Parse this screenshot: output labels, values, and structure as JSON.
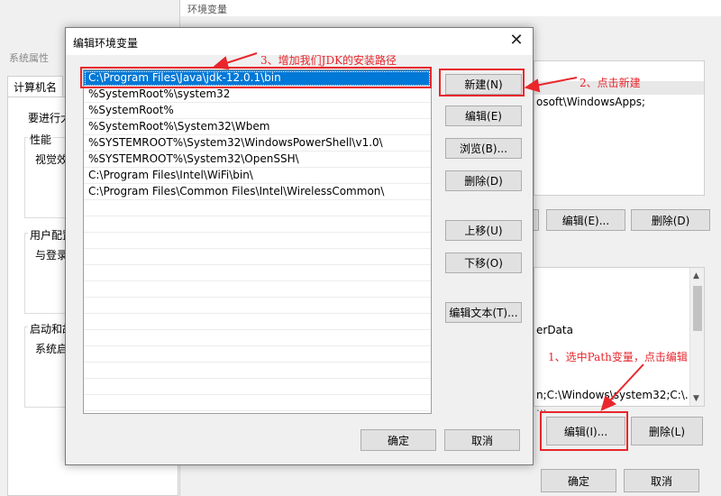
{
  "sysprops": {
    "title": "系统属性",
    "tab": "计算机名",
    "line1": "要进行大",
    "perf_label": "性能",
    "perf_text": "视觉效",
    "user_label": "用户配置",
    "user_text": "与登录",
    "startup_label": "启动和故",
    "startup_text": "系统启"
  },
  "envwin": {
    "title": "环境变量",
    "frag_windowsapps": "osoft\\WindowsApps;",
    "frag_userdata": "erData",
    "frag_path": "n;C:\\Windows\\system32;C:\\...",
    "frag_cut": "...",
    "edit_top_label": "编辑(E)...",
    "delete_top_label": "删除(D)",
    "edit_bottom_label": "编辑(I)...",
    "delete_bottom_label": "删除(L)",
    "ok_label": "确定",
    "cancel_label": "取消"
  },
  "dialog": {
    "title": "编辑环境变量",
    "close_glyph": "✕",
    "paths": [
      "C:\\Program Files\\Java\\jdk-12.0.1\\bin",
      "%SystemRoot%\\system32",
      "%SystemRoot%",
      "%SystemRoot%\\System32\\Wbem",
      "%SYSTEMROOT%\\System32\\WindowsPowerShell\\v1.0\\",
      "%SYSTEMROOT%\\System32\\OpenSSH\\",
      "C:\\Program Files\\Intel\\WiFi\\bin\\",
      "C:\\Program Files\\Common Files\\Intel\\WirelessCommon\\"
    ],
    "new_label": "新建(N)",
    "edit_label": "编辑(E)",
    "browse_label": "浏览(B)...",
    "delete_label": "删除(D)",
    "moveup_label": "上移(U)",
    "movedown_label": "下移(O)",
    "edittext_label": "编辑文本(T)...",
    "ok_label": "确定",
    "cancel_label": "取消"
  },
  "annotations": {
    "step1": "1、选中Path变量，点击编辑",
    "step2": "2、点击新建",
    "step3": "3、增加我们JDK的安装路径",
    "color": "#e8262c"
  }
}
